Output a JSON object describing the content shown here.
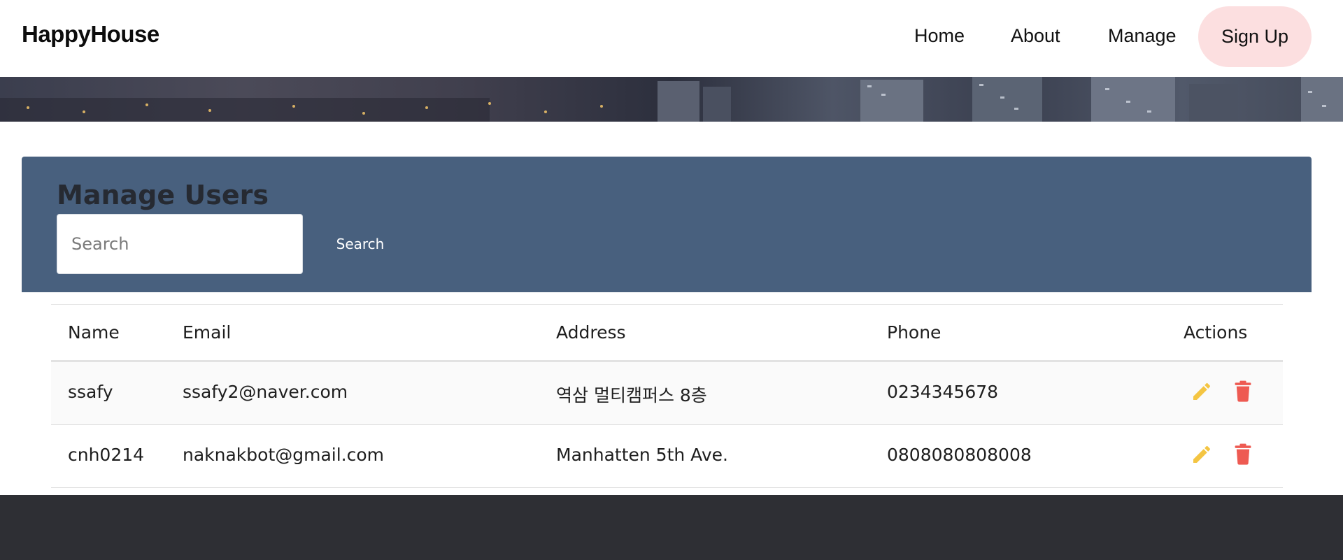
{
  "navbar": {
    "brand": "HappyHouse",
    "links": [
      {
        "label": "Home"
      },
      {
        "label": "About"
      },
      {
        "label": "Manage"
      }
    ],
    "signup_label": "Sign Up"
  },
  "panel": {
    "title": "Manage Users",
    "search_placeholder": "Search",
    "search_value": "",
    "search_button": "Search"
  },
  "table": {
    "headers": {
      "name": "Name",
      "email": "Email",
      "address": "Address",
      "phone": "Phone",
      "actions": "Actions"
    },
    "rows": [
      {
        "name": "ssafy",
        "email": "ssafy2@naver.com",
        "address": "역삼 멀티캠퍼스 8층",
        "phone": "0234345678"
      },
      {
        "name": "cnh0214",
        "email": "naknakbot@gmail.com",
        "address": "Manhatten 5th Ave.",
        "phone": "0808080808008"
      }
    ]
  },
  "icons": {
    "edit": "pencil-icon",
    "delete": "trash-icon"
  },
  "colors": {
    "panel": "#48607e",
    "signup_bg": "#fcdfe0",
    "edit_icon": "#f4c542",
    "delete_icon": "#ee5a52",
    "footer": "#2e2f34"
  }
}
